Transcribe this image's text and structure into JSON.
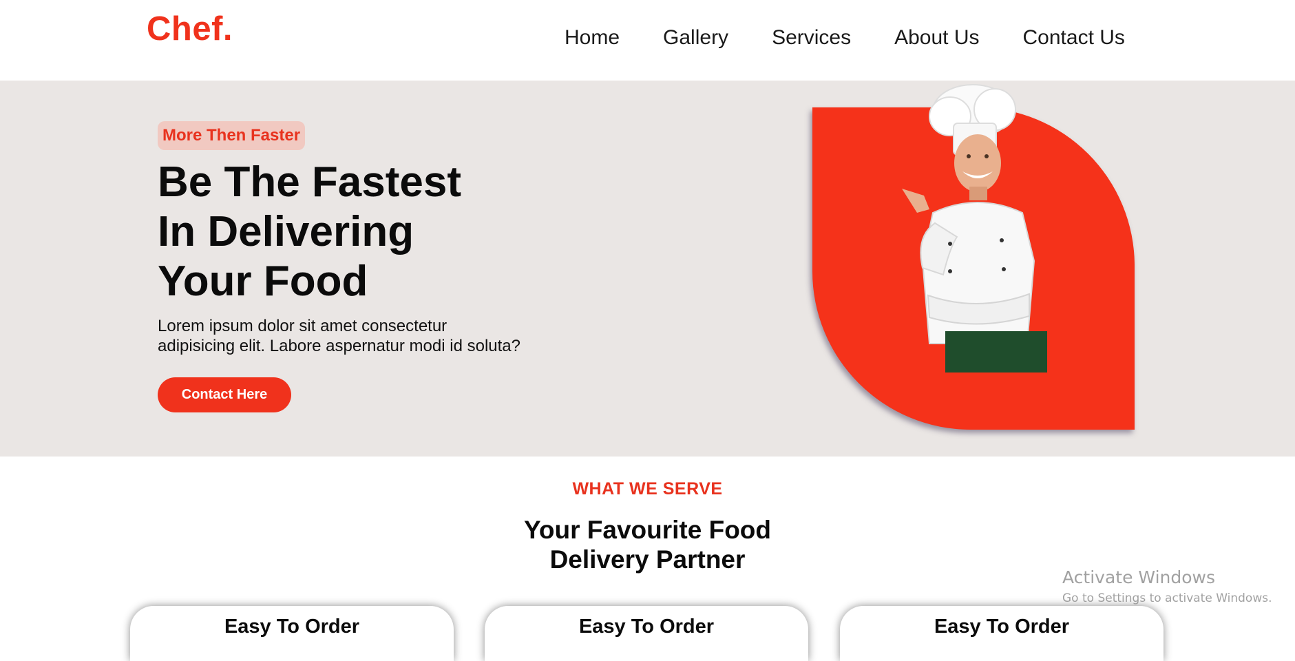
{
  "header": {
    "logo": "Chef.",
    "nav": [
      "Home",
      "Gallery",
      "Services",
      "About Us",
      "Contact Us"
    ]
  },
  "hero": {
    "badge": "More Then Faster",
    "title_lines": [
      "Be The Fastest",
      "In Delivering",
      "Your Food"
    ],
    "description_line1": "Lorem ipsum dolor sit amet consectetur",
    "description_line2": "adipisicing elit. Labore aspernatur modi id soluta?",
    "cta_label": "Contact Here"
  },
  "serve": {
    "kicker": "WHAT WE SERVE",
    "title_lines": [
      "Your Favourite Food",
      "Delivery Partner"
    ],
    "cards": [
      {
        "title": "Easy To Order"
      },
      {
        "title": "Easy To Order"
      },
      {
        "title": "Easy To Order"
      }
    ]
  },
  "watermark": {
    "line1": "Activate Windows",
    "line2": "Go to Settings to activate Windows."
  },
  "colors": {
    "accent": "#f0321c",
    "hero_bg": "#eae6e4",
    "badge_bg": "#f1c9c1"
  },
  "icons": {
    "hero_image": "chef-illustration"
  }
}
